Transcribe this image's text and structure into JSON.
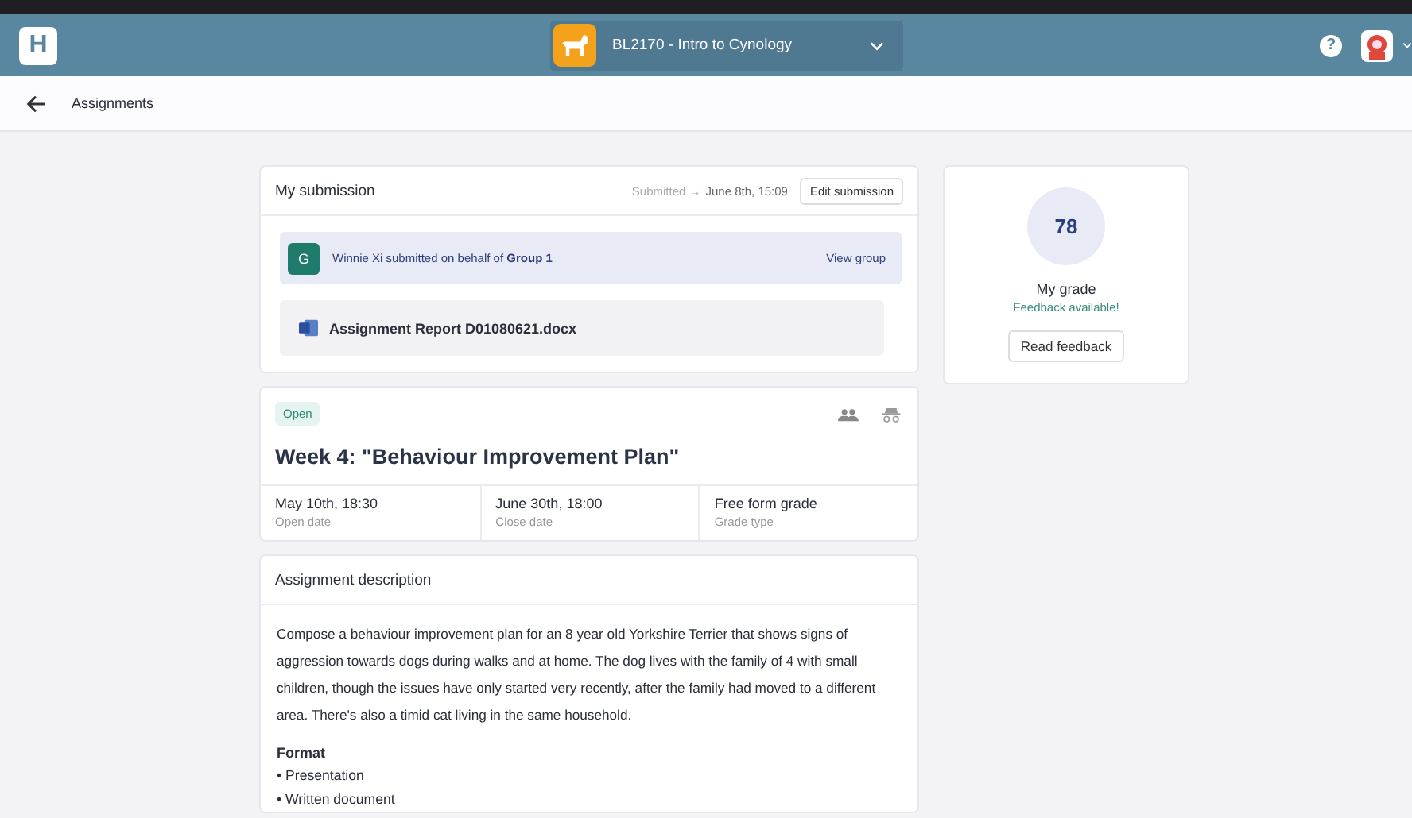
{
  "header": {
    "logo": "H",
    "course": "BL2170 - Intro to Cynology",
    "help": "?"
  },
  "subheader": {
    "title": "Assignments"
  },
  "submission": {
    "title": "My submission",
    "submitted_label": "Submitted →",
    "submitted_date": "June 8th, 15:09",
    "edit_button": "Edit submission",
    "group_notice": {
      "avatar_letter": "G",
      "text": "Winnie Xi submitted on behalf of **Group 1**",
      "link": "View group"
    },
    "file": {
      "name": "Assignment Report D01080621.docx"
    }
  },
  "assignment": {
    "status": "Open",
    "title": "Week 4: \"Behaviour Improvement Plan\"",
    "details": [
      {
        "value": "May 10th, 18:30",
        "label": "Open date"
      },
      {
        "value": "June 30th, 18:00",
        "label": "Close date"
      },
      {
        "value": "Free form grade",
        "label": "Grade type"
      }
    ]
  },
  "description": {
    "title": "Assignment description",
    "text": "Compose a behaviour improvement plan for an 8 year old Yorkshire Terrier that shows signs of aggression towards dogs during walks and at home. The dog lives with the family of 4 with small children, though the issues have only started very recently, after the family had moved to a different area. There's also a timid cat living in the same household.",
    "format_heading": "Format",
    "format_items": [
      "• Presentation",
      "• Written document"
    ]
  },
  "grade": {
    "score": "78",
    "label": "My grade",
    "feedback_note": "Feedback available!",
    "button": "Read feedback"
  }
}
